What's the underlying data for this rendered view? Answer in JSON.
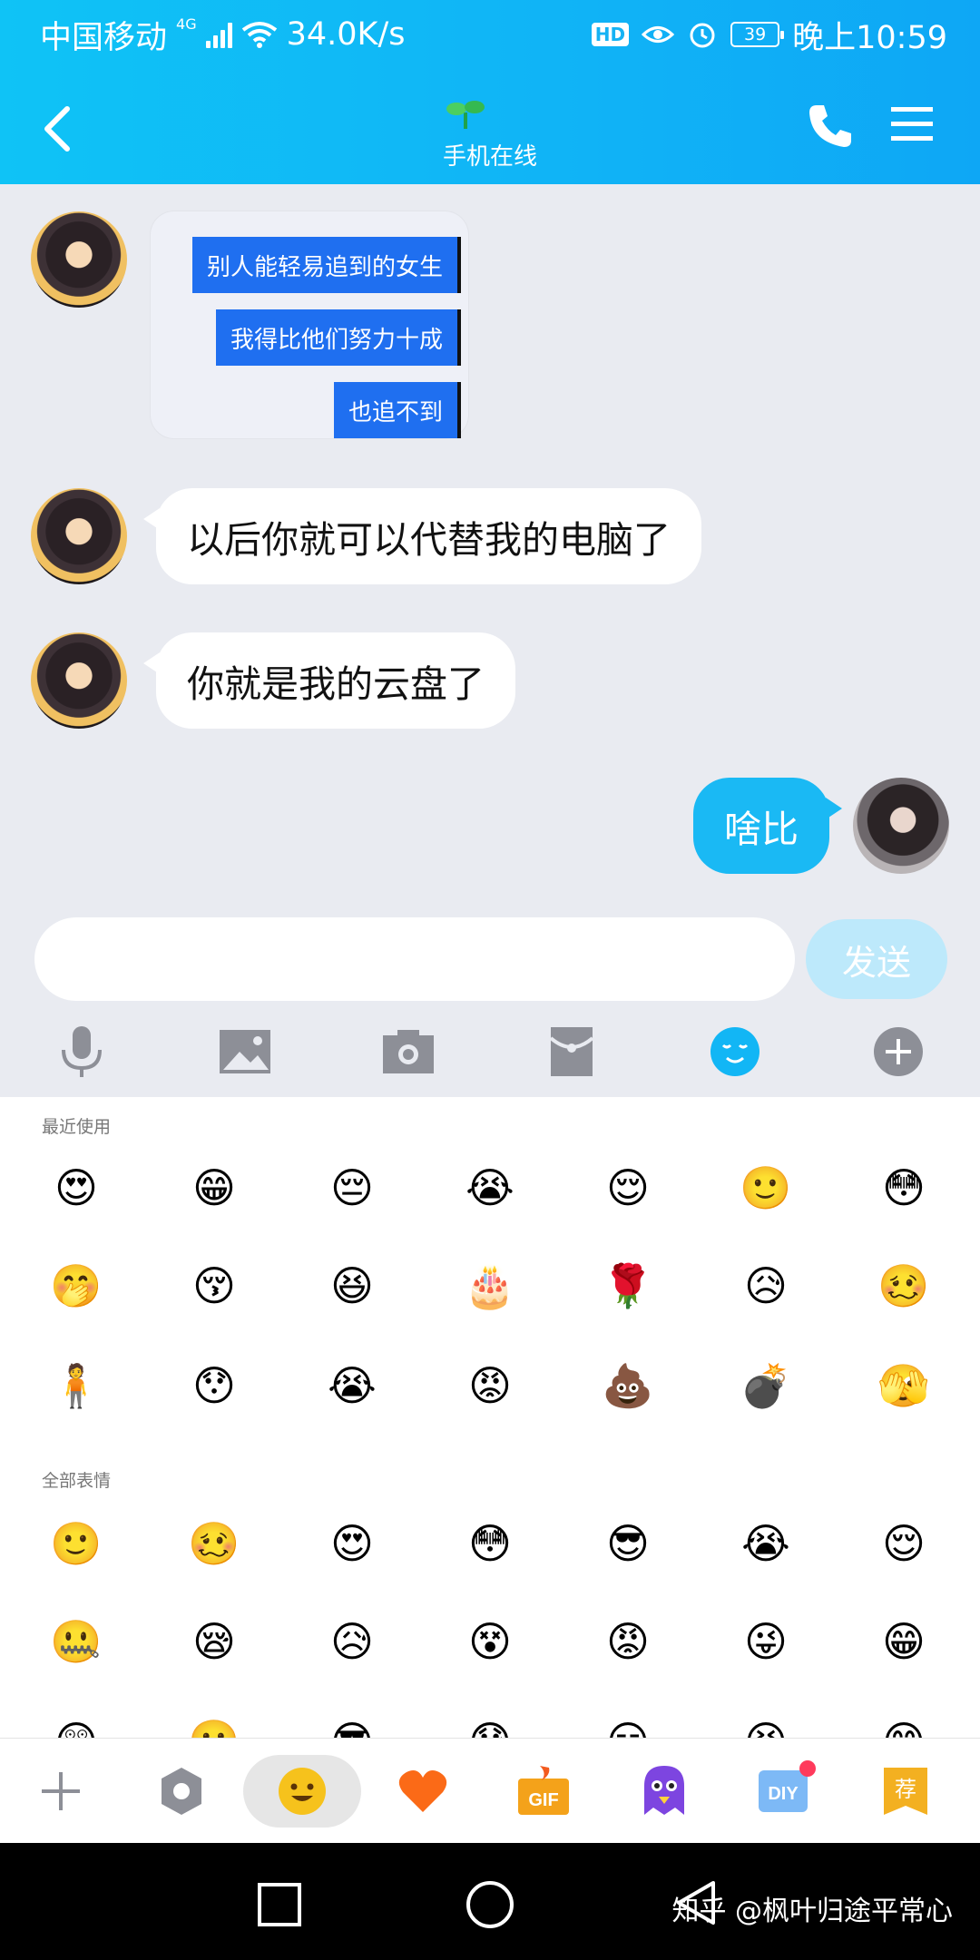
{
  "status_bar": {
    "carrier": "中国移动",
    "network": "4G",
    "speed": "34.0K/s",
    "hd": "HD",
    "battery": "39",
    "time": "晚上10:59"
  },
  "header": {
    "subtitle": "手机在线"
  },
  "messages": {
    "image_lines": [
      "别人能轻易追到的女生",
      "我得比他们努力十成",
      "也追不到"
    ],
    "m1": "以后你就可以代替我的电脑了",
    "m2": "你就是我的云盘了",
    "m3": "啥比"
  },
  "composer": {
    "input_value": "",
    "send_label": "发送"
  },
  "toolbar": {
    "icons": [
      "microphone-icon",
      "image-icon",
      "camera-icon",
      "red-packet-icon",
      "emoji-icon",
      "plus-icon"
    ],
    "active": "emoji-icon"
  },
  "emoji_panel": {
    "recent_label": "最近使用",
    "all_label": "全部表情",
    "recent": [
      "😍",
      "😁",
      "😔",
      "😭",
      "😌",
      "🙂",
      "😳",
      "🤭",
      "😚",
      "😆",
      "🎂",
      "🌹",
      "😥",
      "🥴",
      "🧍",
      "😯",
      "😭",
      "😡",
      "💩",
      "💣",
      "🫣"
    ],
    "all": [
      "🙂",
      "🥴",
      "😍",
      "😳",
      "😎",
      "😭",
      "😌",
      "🤐",
      "😪",
      "😥",
      "😵",
      "😡",
      "😜",
      "😁",
      "😲",
      "🙂",
      "😎",
      "😰",
      "😑",
      "😣",
      "😊"
    ]
  },
  "bottom_bar": {
    "icons": [
      "plus-icon",
      "settings-icon",
      "smiley-icon",
      "heart-icon",
      "gif-icon",
      "ghost-icon",
      "diy-icon",
      "recommend-icon"
    ],
    "gif": "GIF",
    "diy": "DIY",
    "recommend": "荐",
    "active": "smiley-icon"
  },
  "watermark": "知乎 @枫叶归途平常心"
}
